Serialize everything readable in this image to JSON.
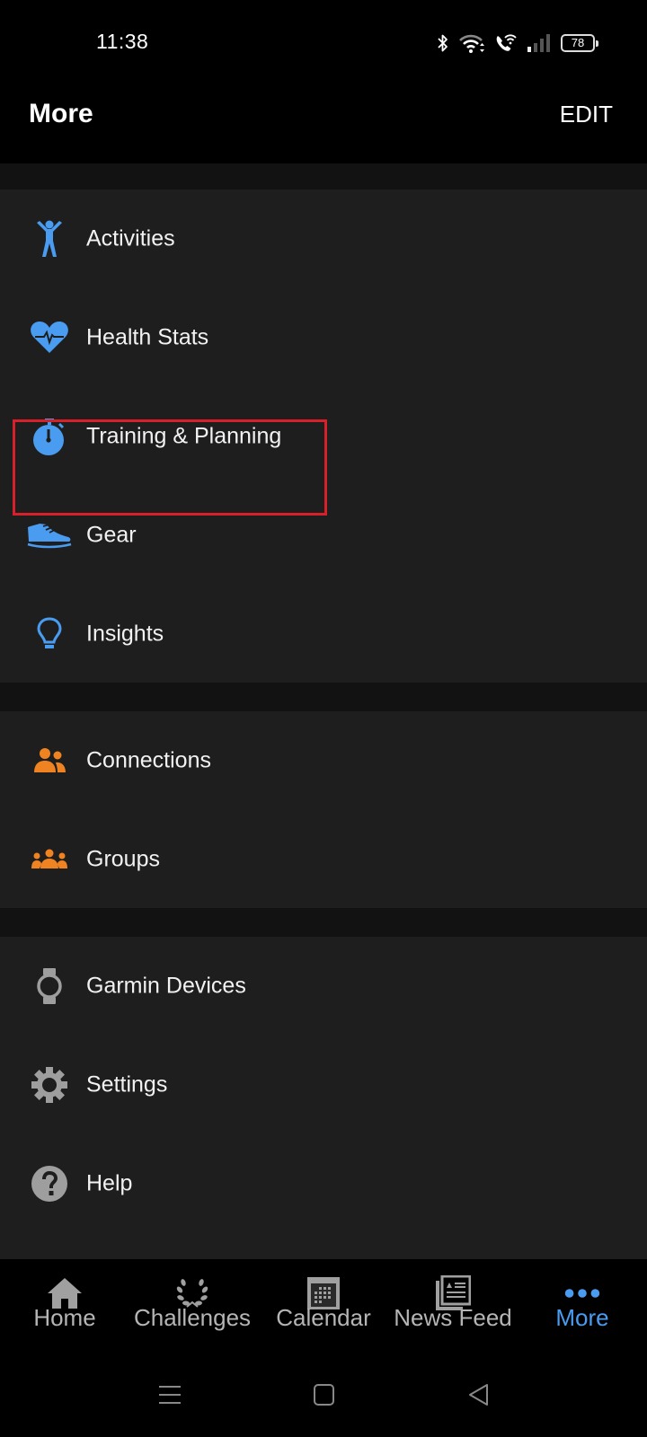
{
  "status_bar": {
    "time": "11:38",
    "icons": [
      "bluetooth-icon",
      "wifi-icon",
      "wifi-calling-icon",
      "signal-icon",
      "battery-icon"
    ],
    "battery_level": "78"
  },
  "header": {
    "title": "More",
    "edit_label": "EDIT"
  },
  "sections": [
    {
      "items": [
        {
          "label": "Activities",
          "icon": "activities-icon",
          "color": "#4a9cf0"
        },
        {
          "label": "Health Stats",
          "icon": "heart-rate-icon",
          "color": "#4a9cf0"
        },
        {
          "label": "Training & Planning",
          "icon": "stopwatch-icon",
          "color": "#4a9cf0",
          "highlighted": true
        },
        {
          "label": "Gear",
          "icon": "shoe-icon",
          "color": "#4a9cf0"
        },
        {
          "label": "Insights",
          "icon": "lightbulb-icon",
          "color": "#4a9cf0"
        }
      ]
    },
    {
      "items": [
        {
          "label": "Connections",
          "icon": "connections-icon",
          "color": "#f08321"
        },
        {
          "label": "Groups",
          "icon": "groups-icon",
          "color": "#f08321"
        }
      ]
    },
    {
      "items": [
        {
          "label": "Garmin Devices",
          "icon": "watch-icon",
          "color": "#9e9e9e"
        },
        {
          "label": "Settings",
          "icon": "gear-icon",
          "color": "#9e9e9e"
        },
        {
          "label": "Help",
          "icon": "help-icon",
          "color": "#9e9e9e"
        }
      ]
    }
  ],
  "highlight_color": "#d8202a",
  "bottom_nav": {
    "items": [
      {
        "label": "Home",
        "icon": "home-icon",
        "active": false
      },
      {
        "label": "Challenges",
        "icon": "laurel-icon",
        "active": false
      },
      {
        "label": "Calendar",
        "icon": "calendar-icon",
        "active": false
      },
      {
        "label": "News Feed",
        "icon": "news-feed-icon",
        "active": false
      },
      {
        "label": "More",
        "icon": "more-dots-icon",
        "active": true
      }
    ],
    "active_color": "#4a9cf0",
    "inactive_color": "#b5b5b5"
  },
  "system_nav": {
    "buttons": [
      "recents-icon",
      "home-circle-icon",
      "back-icon"
    ]
  }
}
